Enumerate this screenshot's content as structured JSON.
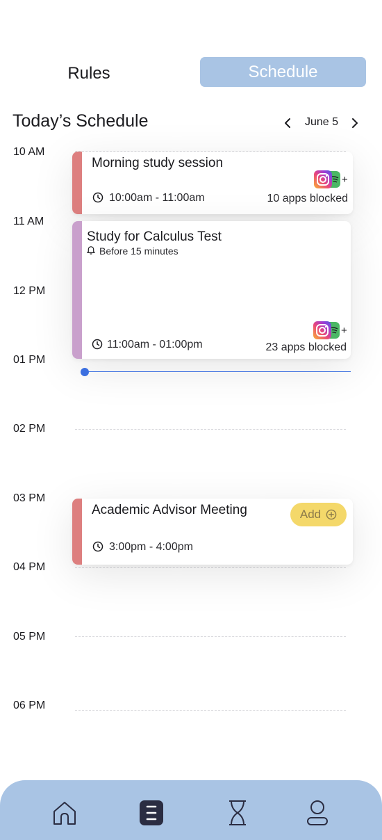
{
  "header": {
    "tabs": [
      {
        "label": "Rules",
        "active": false
      },
      {
        "label": "Schedule",
        "active": true
      }
    ]
  },
  "schedule": {
    "title": "Today’s Schedule",
    "date": "June 5",
    "hours": [
      "10 AM",
      "11 AM",
      "12 PM",
      "01 PM",
      "02 PM",
      "03 PM",
      "04 PM",
      "05 PM",
      "06 PM"
    ]
  },
  "events": [
    {
      "title": "Morning study session",
      "time": "10:00am - 11:00am",
      "blocked": "10 apps blocked",
      "accent": "#dd7f7f"
    },
    {
      "title": "Study for Calculus Test",
      "reminder": "Before 15 minutes",
      "time": "11:00am - 01:00pm",
      "blocked": "23 apps blocked",
      "accent": "#c9a0cc"
    },
    {
      "title": "Academic Advisor Meeting",
      "time": "3:00pm - 4:00pm",
      "add_label": "Add",
      "accent": "#dd7f7f"
    }
  ],
  "apps": {
    "plus": "+",
    "icons": [
      "instagram-icon",
      "spotify-icon"
    ]
  },
  "colors": {
    "tab_active": "#a9c4e4",
    "nav_bar": "#a9c4e4",
    "now_line": "#3b6fe0",
    "add_button": "#f4d86a",
    "nav_active": "#2b2d42"
  },
  "bottom_nav": {
    "items": [
      "home-icon",
      "schedule-icon",
      "hourglass-icon",
      "profile-icon"
    ],
    "active": "schedule-icon"
  }
}
